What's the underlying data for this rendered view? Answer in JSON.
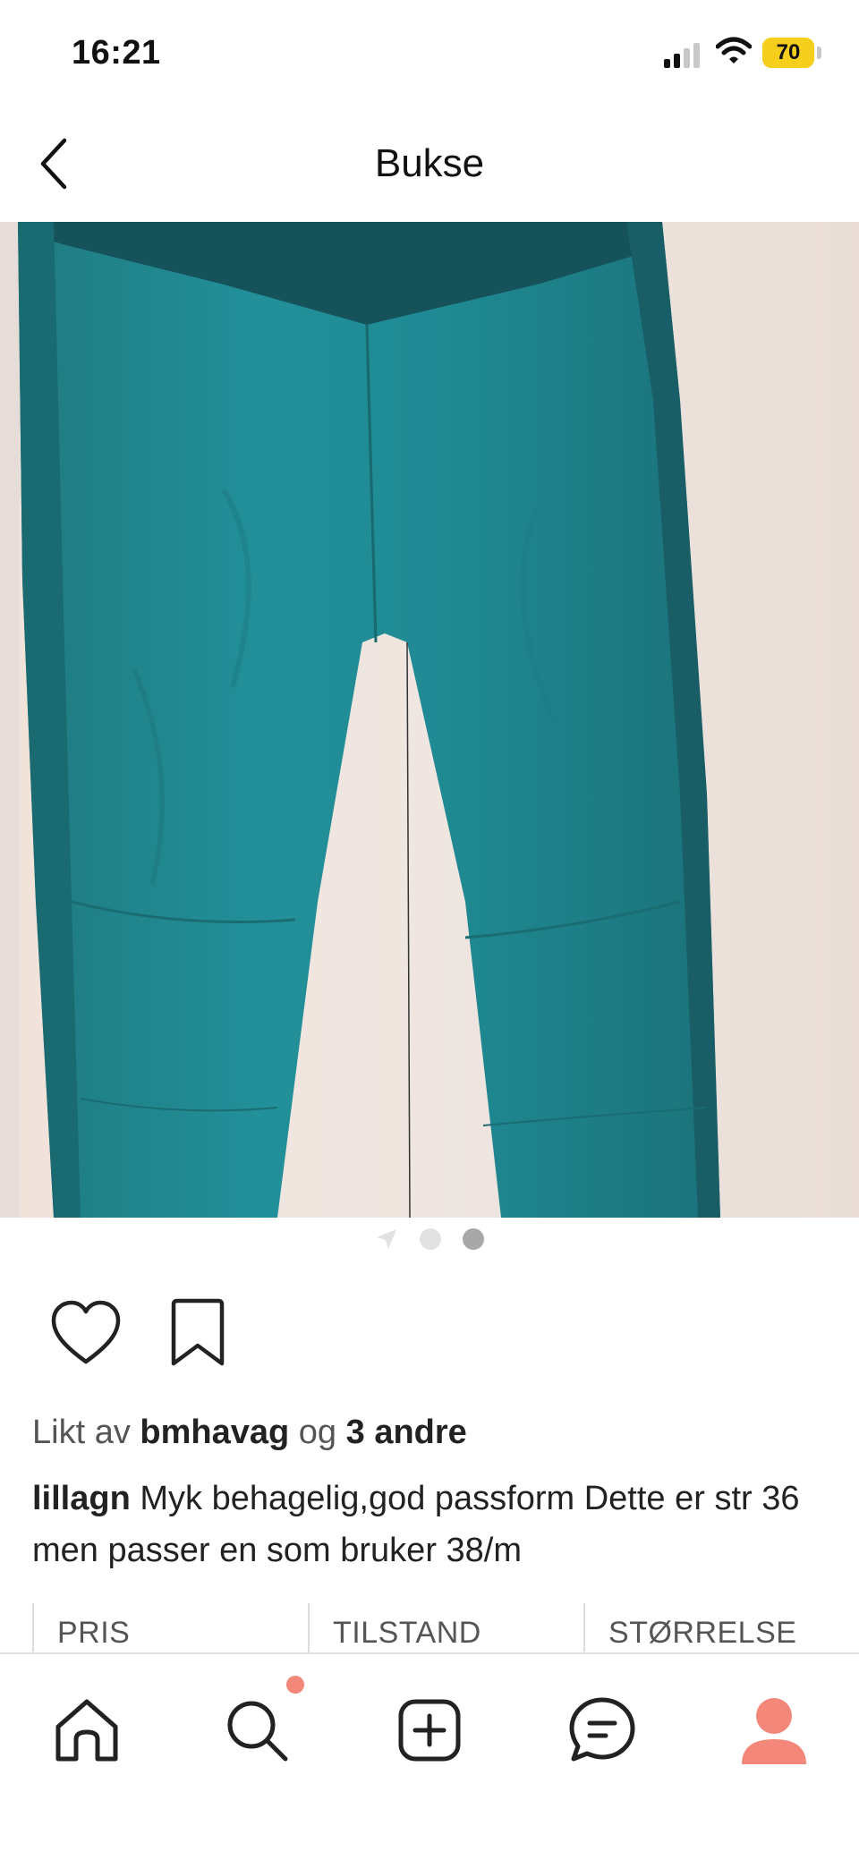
{
  "status_bar": {
    "time": "16:21",
    "battery": "70"
  },
  "header": {
    "title": "Bukse"
  },
  "carousel": {
    "page_count": 3,
    "active_index": 2
  },
  "post": {
    "likes_prefix": "Likt av",
    "liked_by": "bmhavag",
    "likes_connector": "og",
    "likes_others": "3 andre",
    "author": "lillagn",
    "caption": "Myk behagelig,god passform Dette er str 36 men passer en som bruker 38/m"
  },
  "details": {
    "price_label": "PRIS",
    "condition_label": "TILSTAND",
    "size_label": "STØRRELSE"
  },
  "tab_bar": {
    "items": [
      "home-icon",
      "search-icon",
      "add-icon",
      "chat-icon",
      "profile-icon"
    ],
    "search_has_notification": true,
    "accent_color": "#f2877a"
  }
}
